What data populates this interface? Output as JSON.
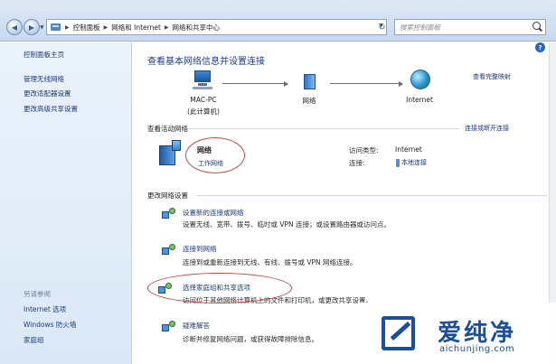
{
  "address_bar": {
    "crumbs": [
      "控制面板",
      "网络和 Internet",
      "网络和共享中心"
    ],
    "search_placeholder": "搜索控制面板"
  },
  "left_pane": {
    "home_link": "控制面板主页",
    "links": [
      "管理无线网络",
      "更改适配器设置",
      "更改高级共享设置"
    ],
    "see_also_label": "另请参阅",
    "see_also_links": [
      "Internet 选项",
      "Windows 防火墙",
      "家庭组"
    ]
  },
  "main": {
    "title": "查看基本网络信息并设置连接",
    "full_map_link": "查看完整映射",
    "map": {
      "computer_name": "MAC-PC",
      "computer_caption": "(此计算机)",
      "network_label": "网络",
      "internet_label": "Internet"
    },
    "active_networks": {
      "heading": "查看活动网络",
      "connect_link": "连接或断开连接",
      "network_name": "网络",
      "network_type_link": "工作网络",
      "access_type_label": "访问类型:",
      "access_type_value": "Internet",
      "connection_label": "连接:",
      "connection_value": "本地连接"
    },
    "settings": {
      "heading": "更改网络设置",
      "tasks": [
        {
          "link": "设置新的连接或网络",
          "desc": "设置无线、宽带、拨号、临时或 VPN 连接；或设置路由器或访问点。"
        },
        {
          "link": "连接到网络",
          "desc": "连接到或重新连接到无线、有线、拨号或 VPN 网络连接。"
        },
        {
          "link": "选择家庭组和共享选项",
          "desc": "访问位于其他网络计算机上的文件和打印机，或更改共享设置。"
        },
        {
          "link": "疑难解答",
          "desc": "诊断并修复网络问题，或获得故障排除信息。"
        }
      ]
    }
  },
  "watermark": {
    "text": "爱纯净",
    "url": "aichunjing.com"
  },
  "colors": {
    "link": "#1b3a7a",
    "title": "#1b3d8c",
    "annotation": "#c64848",
    "watermark": "#1b4f9c"
  }
}
